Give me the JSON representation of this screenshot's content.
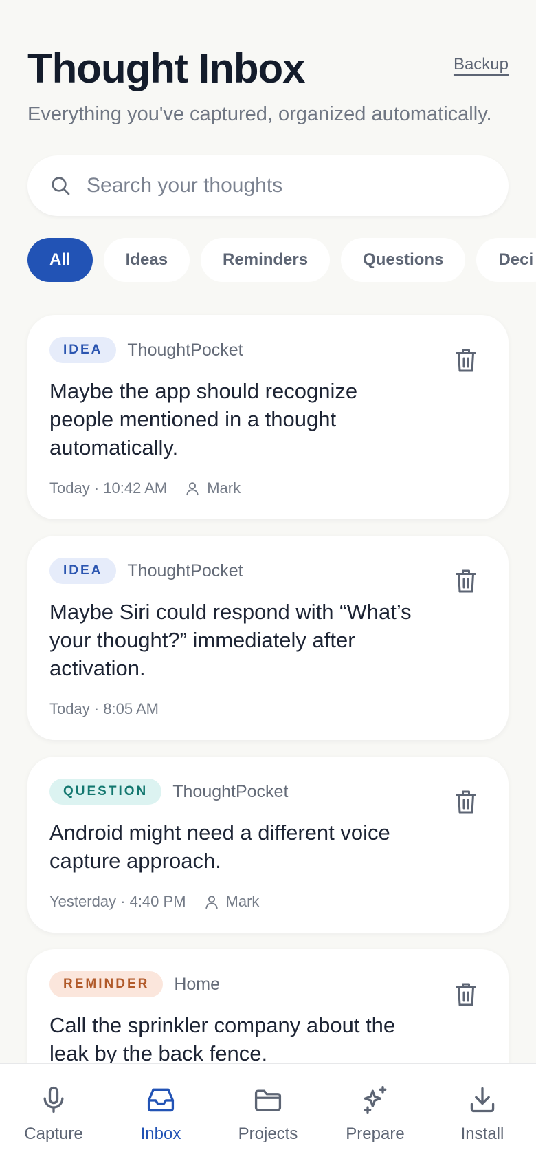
{
  "header": {
    "title": "Thought Inbox",
    "subtitle": "Everything you've captured, organized automatically.",
    "backup_label": "Backup"
  },
  "search": {
    "placeholder": "Search your thoughts",
    "value": ""
  },
  "filters": [
    "All",
    "Ideas",
    "Reminders",
    "Questions",
    "Deci"
  ],
  "active_filter": "All",
  "thoughts": [
    {
      "type": "IDEA",
      "project": "ThoughtPocket",
      "text": "Maybe the app should recognize people mentioned in a thought automatically.",
      "time": "Today · 10:42 AM",
      "person": "Mark"
    },
    {
      "type": "IDEA",
      "project": "ThoughtPocket",
      "text": "Maybe Siri could respond with “What’s your thought?” immediately after activation.",
      "time": "Today · 8:05 AM",
      "person": ""
    },
    {
      "type": "QUESTION",
      "project": "ThoughtPocket",
      "text": "Android might need a different voice capture approach.",
      "time": "Yesterday · 4:40 PM",
      "person": "Mark"
    },
    {
      "type": "REMINDER",
      "project": "Home",
      "text": "Call the sprinkler company about the leak by the back fence.",
      "time": "",
      "person": ""
    }
  ],
  "tabs": [
    {
      "label": "Capture",
      "icon": "microphone-icon"
    },
    {
      "label": "Inbox",
      "icon": "inbox-icon",
      "active": true
    },
    {
      "label": "Projects",
      "icon": "folder-icon"
    },
    {
      "label": "Prepare",
      "icon": "sparkles-icon"
    },
    {
      "label": "Install",
      "icon": "download-icon"
    }
  ],
  "colors": {
    "background": "#f8f8f5",
    "accent": "#2253b5",
    "idea": "#2b55b0",
    "question": "#13776f",
    "reminder": "#b15a2a"
  }
}
